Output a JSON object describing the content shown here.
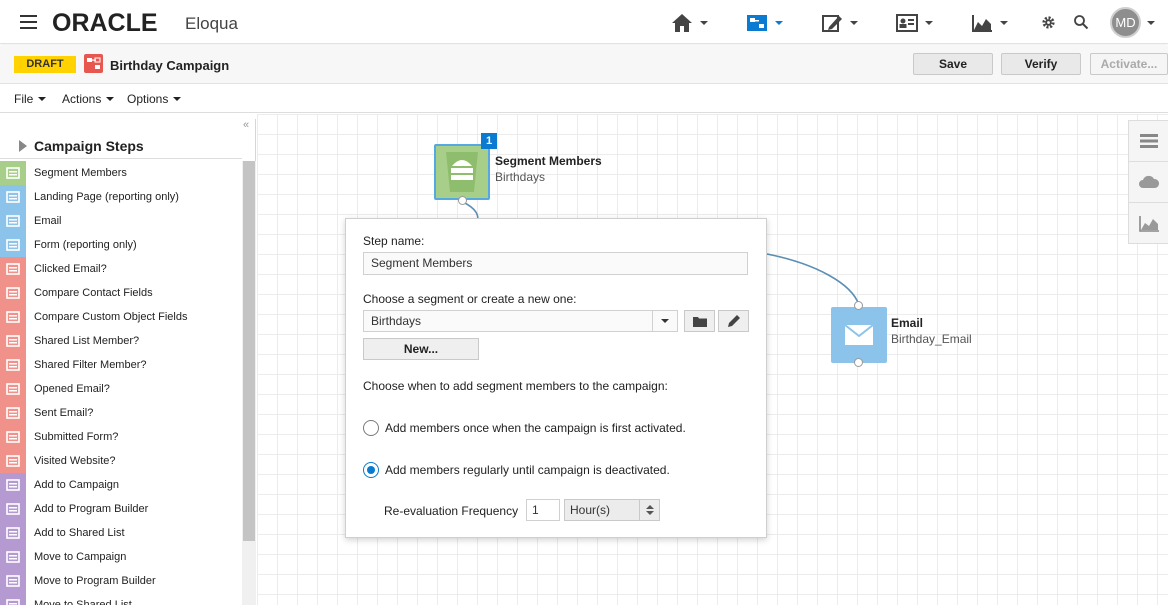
{
  "app": {
    "logo": "ORACLE",
    "product": "Eloqua",
    "user_initials": "MD"
  },
  "header": {
    "nav": [
      {
        "icon": "home-icon"
      },
      {
        "icon": "orchestration-icon",
        "active": true
      },
      {
        "icon": "assets-icon"
      },
      {
        "icon": "contacts-icon"
      },
      {
        "icon": "insight-icon"
      }
    ]
  },
  "titlebar": {
    "status_badge": "DRAFT",
    "campaign_name": "Birthday Campaign",
    "save_label": "Save",
    "verify_label": "Verify",
    "activate_label": "Activate..."
  },
  "menubar": {
    "file": "File",
    "actions": "Actions",
    "options": "Options"
  },
  "sidebar": {
    "collapse_glyph": "«",
    "title": "Campaign Steps",
    "items": [
      {
        "label": "Segment Members",
        "color": "#a8cf8a"
      },
      {
        "label": "Landing Page (reporting only)",
        "color": "#8cc3ea"
      },
      {
        "label": "Email",
        "color": "#8cc3ea"
      },
      {
        "label": "Form (reporting only)",
        "color": "#8cc3ea"
      },
      {
        "label": "Clicked Email?",
        "color": "#f1928a"
      },
      {
        "label": "Compare Contact Fields",
        "color": "#f1928a"
      },
      {
        "label": "Compare Custom Object Fields",
        "color": "#f1928a"
      },
      {
        "label": "Shared List Member?",
        "color": "#f1928a"
      },
      {
        "label": "Shared Filter Member?",
        "color": "#f1928a"
      },
      {
        "label": "Opened Email?",
        "color": "#f1928a"
      },
      {
        "label": "Sent Email?",
        "color": "#f1928a"
      },
      {
        "label": "Submitted Form?",
        "color": "#f1928a"
      },
      {
        "label": "Visited Website?",
        "color": "#f1928a"
      },
      {
        "label": "Add to Campaign",
        "color": "#b49ad1"
      },
      {
        "label": "Add to Program Builder",
        "color": "#b49ad1"
      },
      {
        "label": "Add to Shared List",
        "color": "#b49ad1"
      },
      {
        "label": "Move to Campaign",
        "color": "#b49ad1"
      },
      {
        "label": "Move to Program Builder",
        "color": "#b49ad1"
      },
      {
        "label": "Move to Shared List",
        "color": "#b49ad1"
      }
    ]
  },
  "canvas": {
    "segment_node": {
      "badge": "1",
      "title": "Segment Members",
      "subtitle": "Birthdays"
    },
    "email_node": {
      "title": "Email",
      "subtitle": "Birthday_Email"
    }
  },
  "popup": {
    "step_name_label": "Step name:",
    "step_name_value": "Segment Members",
    "segment_label": "Choose a segment or create a new one:",
    "segment_value": "Birthdays",
    "new_button": "New...",
    "when_label": "Choose when to add segment members to the campaign:",
    "option_once": "Add members once when the campaign is first activated.",
    "option_regular": "Add members regularly until campaign is deactivated.",
    "selected_option": "regular",
    "frequency_label": "Re-evaluation Frequency",
    "frequency_value": "1",
    "frequency_unit": "Hour(s)"
  }
}
